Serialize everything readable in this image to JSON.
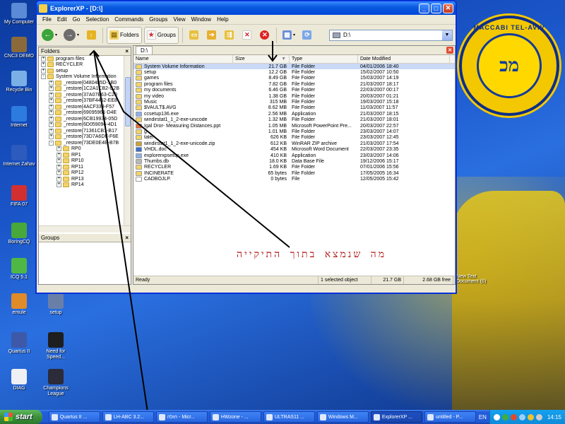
{
  "desktop": {
    "icons": [
      {
        "label": "My Computer",
        "icon": "computer-icon",
        "color": "#5b8ad6"
      },
      {
        "label": "CNC3 DEMO",
        "icon": "game-icon",
        "color": "#8a6a3a"
      },
      {
        "label": "Recycle Bin",
        "icon": "recycle-bin-icon",
        "color": "#7ab0e6"
      },
      {
        "label": "Internet",
        "icon": "internet-icon",
        "color": "#2e7be0"
      },
      {
        "label": "Internet Zahav",
        "icon": "internet-zahav-icon",
        "color": "#2d5bbd"
      },
      {
        "label": "FIFA 07",
        "icon": "fifa-icon",
        "color": "#d23030"
      },
      {
        "label": "BoringCQ",
        "icon": "boringcq-icon",
        "color": "#49a83a"
      },
      {
        "label": "ICQ 5.1",
        "icon": "icq-icon",
        "color": "#4fb844"
      },
      {
        "label": "emule",
        "icon": "emule-icon",
        "color": "#e08b2a"
      },
      {
        "label": "setup",
        "icon": "setup-icon",
        "color": "#6a7fa8"
      },
      {
        "label": "Quartus II",
        "icon": "quartus-icon",
        "color": "#3d59a8"
      },
      {
        "label": "Need for Speed...",
        "icon": "nfs-icon",
        "color": "#1e1e1e"
      },
      {
        "label": "DIAG",
        "icon": "document-icon",
        "color": "#eef0f4"
      },
      {
        "label": "Champions League",
        "icon": "champions-icon",
        "color": "#2b2b3a"
      }
    ],
    "background_text": "New Text Document (6)",
    "logo": {
      "ring_text": "MACCABI TEL-AVIV",
      "center_text": "מכ"
    },
    "annotation": "מה שנמצא בתוך התיקייה"
  },
  "window": {
    "title": "ExplorerXP - [D:\\]",
    "menu": [
      "File",
      "Edit",
      "Go",
      "Selection",
      "Commands",
      "Groups",
      "View",
      "Window",
      "Help"
    ],
    "toolbar": {
      "folders_label": "Folders",
      "groups_label": "Groups",
      "address": "D:\\"
    },
    "left_pane": {
      "folders_title": "Folders",
      "groups_title": "Groups",
      "tree": [
        {
          "label": "program files",
          "indent": 0,
          "pm": "+"
        },
        {
          "label": "RECYCLER",
          "indent": 0,
          "pm": "+"
        },
        {
          "label": "setup",
          "indent": 0,
          "pm": "+"
        },
        {
          "label": "System Volume Information",
          "indent": 0,
          "pm": "-"
        },
        {
          "label": "_restore{0480485D-1B0",
          "indent": 1,
          "pm": "+"
        },
        {
          "label": "_restore{1C2A1CB2-C2B",
          "indent": 1,
          "pm": "+"
        },
        {
          "label": "_restore{37A07B63-C20",
          "indent": 1,
          "pm": "+"
        },
        {
          "label": "_restore{37BF4462-EE8",
          "indent": 1,
          "pm": "+"
        },
        {
          "label": "_restore{4ACF338-F57",
          "indent": 1,
          "pm": "+"
        },
        {
          "label": "_restore{69095961-D4E",
          "indent": 1,
          "pm": "+"
        },
        {
          "label": "_restore{6CB19934-05D",
          "indent": 1,
          "pm": "+"
        },
        {
          "label": "_restore{6D059096-4D1",
          "indent": 1,
          "pm": "+"
        },
        {
          "label": "_restore{71361CB1-B17",
          "indent": 1,
          "pm": "+"
        },
        {
          "label": "_restore{73D7A6DF-F6E",
          "indent": 1,
          "pm": "+"
        },
        {
          "label": "_restore{73DE0E4E-B7B",
          "indent": 1,
          "pm": "-"
        },
        {
          "label": "RP0",
          "indent": 2,
          "pm": "+"
        },
        {
          "label": "RP1",
          "indent": 2,
          "pm": "+"
        },
        {
          "label": "RP10",
          "indent": 2,
          "pm": "+"
        },
        {
          "label": "RP11",
          "indent": 2,
          "pm": "+"
        },
        {
          "label": "RP12",
          "indent": 2,
          "pm": "+"
        },
        {
          "label": "RP13",
          "indent": 2,
          "pm": "+"
        },
        {
          "label": "RP14",
          "indent": 2,
          "pm": "+"
        }
      ]
    },
    "right_pane": {
      "tab": "D:\\",
      "columns": [
        "Name",
        "Size",
        "Type",
        "Date Modified"
      ],
      "files": [
        {
          "name": "System Volume Information",
          "size": "21.7 GB",
          "type": "File Folder",
          "date": "04/01/2006 18:40",
          "kind": "folder",
          "selected": true
        },
        {
          "name": "setup",
          "size": "12.2 GB",
          "type": "File Folder",
          "date": "15/02/2007 10:50",
          "kind": "folder"
        },
        {
          "name": "games",
          "size": "8.49 GB",
          "type": "File Folder",
          "date": "15/03/2007 14:19",
          "kind": "folder"
        },
        {
          "name": "program files",
          "size": "7.82 GB",
          "type": "File Folder",
          "date": "21/03/2007 18:17",
          "kind": "folder"
        },
        {
          "name": "my documents",
          "size": "6.46 GB",
          "type": "File Folder",
          "date": "22/03/2007 00:17",
          "kind": "folder"
        },
        {
          "name": "my video",
          "size": "1.38 GB",
          "type": "File Folder",
          "date": "20/03/2007 01:21",
          "kind": "folder"
        },
        {
          "name": "Music",
          "size": "315 MB",
          "type": "File Folder",
          "date": "19/03/2007 15:18",
          "kind": "folder"
        },
        {
          "name": "$VAULT$.AVG",
          "size": "8.62 MB",
          "type": "File Folder",
          "date": "11/03/2007 11:57",
          "kind": "folder"
        },
        {
          "name": "ccsetup136.exe",
          "size": "2.56 MB",
          "type": "Application",
          "date": "21/03/2007 18:15",
          "kind": "app"
        },
        {
          "name": "windirstat1_1_2-exe-unicode",
          "size": "1.32 MB",
          "type": "File Folder",
          "date": "21/03/2007 18:01",
          "kind": "folder"
        },
        {
          "name": "Igal Dror- Measuring Distances.ppt",
          "size": "1.05 MB",
          "type": "Microsoft PowerPoint Pre...",
          "date": "20/03/2007 22:57",
          "kind": "ppt"
        },
        {
          "name": "g",
          "size": "1.01 MB",
          "type": "File Folder",
          "date": "23/03/2007 14:07",
          "kind": "folder"
        },
        {
          "name": "talel",
          "size": "626 KB",
          "type": "File Folder",
          "date": "23/03/2007 12:45",
          "kind": "folder"
        },
        {
          "name": "windirstat1_1_2-exe-unicode.zip",
          "size": "612 KB",
          "type": "WinRAR ZIP archive",
          "date": "21/03/2007 17:54",
          "kind": "zip"
        },
        {
          "name": "VHDL.doc",
          "size": "454 KB",
          "type": "Microsoft Word Document",
          "date": "22/03/2007 23:35",
          "kind": "doc"
        },
        {
          "name": "explorerxpsetup.exe",
          "size": "410 KB",
          "type": "Application",
          "date": "23/03/2007 14:06",
          "kind": "app"
        },
        {
          "name": "Thumbs.db",
          "size": "18.0 KB",
          "type": "Data Base File",
          "date": "19/12/2006 15:17",
          "kind": "db"
        },
        {
          "name": "RECYCLER",
          "size": "1.69 KB",
          "type": "File Folder",
          "date": "07/01/2006 15:56",
          "kind": "folder"
        },
        {
          "name": "INCINERATE",
          "size": "65 bytes",
          "type": "File Folder",
          "date": "17/05/2005 16:34",
          "kind": "folder"
        },
        {
          "name": "CADBOJLP.",
          "size": "0 bytes",
          "type": "File",
          "date": "12/05/2005 15:42",
          "kind": "file"
        }
      ]
    },
    "status": {
      "left": "Ready",
      "selected": "1 selected object",
      "size": "21.7 GB",
      "free": "2.68 GB free"
    }
  },
  "taskbar": {
    "start_label": "start",
    "tasks": [
      {
        "label": "Quartus II ..."
      },
      {
        "label": "LH-ABC 3.2..."
      },
      {
        "label": "הולה - Micr..."
      },
      {
        "label": "HWzone - ..."
      },
      {
        "label": "ULTRAS11 ..."
      },
      {
        "label": "Windows M..."
      },
      {
        "label": "ExplorerXP ...",
        "active": true
      },
      {
        "label": "untitled - P..."
      }
    ],
    "language": "EN",
    "clock": "14:15"
  },
  "colors": {
    "accent": "#0a5be0",
    "selection": "#c9d9f6",
    "annotation": "#b01010",
    "folder": "#f1d46a"
  }
}
